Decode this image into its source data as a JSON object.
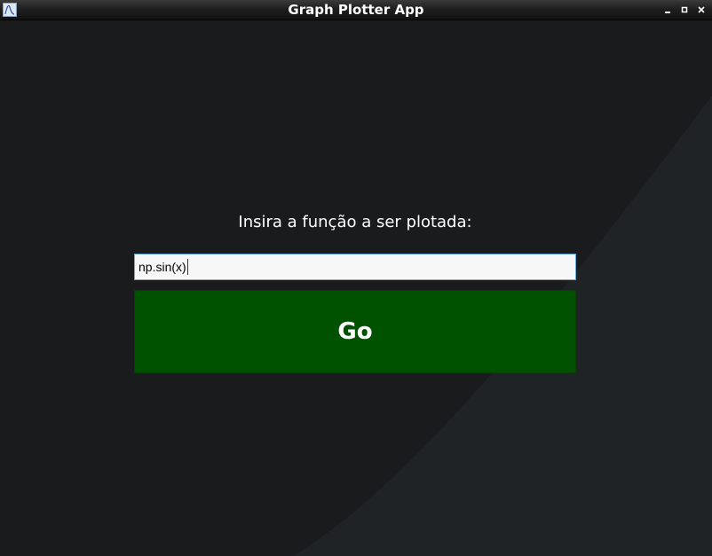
{
  "window": {
    "title": "Graph Plotter App",
    "app_icon": "plot-icon",
    "controls": {
      "minimize_icon": "minimize-icon",
      "maximize_icon": "maximize-icon",
      "close_icon": "close-icon"
    }
  },
  "main": {
    "prompt_label": "Insira a função a ser plotada:",
    "function_input": {
      "value": "np.sin(x)",
      "placeholder": ""
    },
    "go_button_label": "Go"
  },
  "colors": {
    "background": "#191b1c",
    "button": "#005200",
    "input_border": "#63a9d1",
    "caret": "#c00000"
  }
}
